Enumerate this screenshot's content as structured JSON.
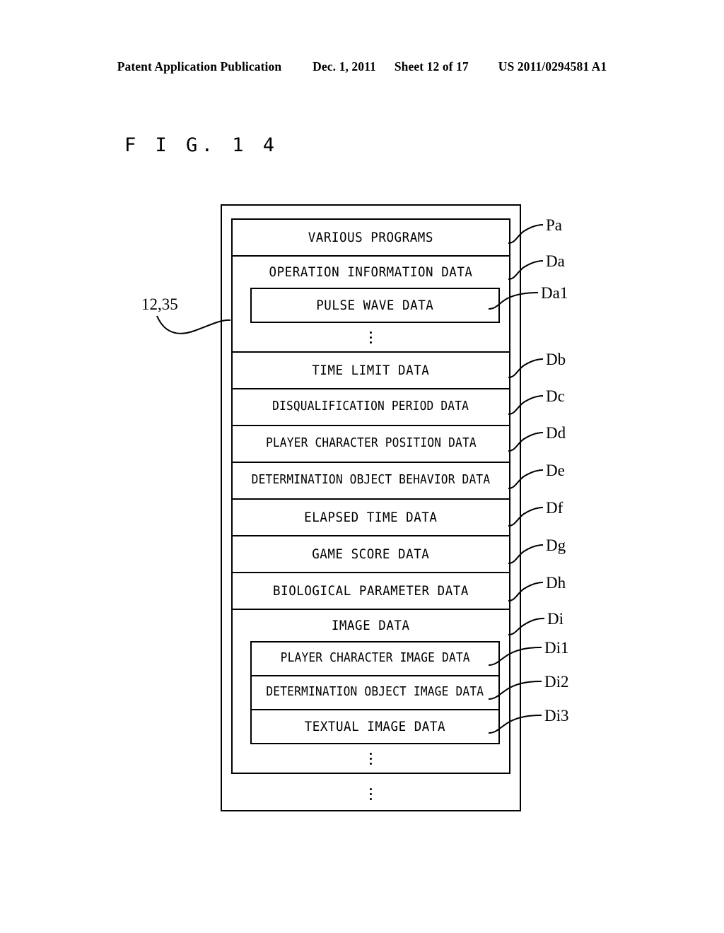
{
  "header": {
    "publication": "Patent Application Publication",
    "date": "Dec. 1, 2011",
    "sheet": "Sheet 12 of 17",
    "doc_number": "US 2011/0294581 A1"
  },
  "figure": {
    "title": "F I G.  1 4",
    "memory_ref": "12,35"
  },
  "diagram": {
    "rows": [
      {
        "id": "various-programs",
        "text": "VARIOUS PROGRAMS",
        "ref": "Pa"
      },
      {
        "id": "operation-information-data",
        "text": "OPERATION INFORMATION DATA",
        "ref": "Da"
      },
      {
        "id": "pulse-wave-data",
        "text": "PULSE WAVE DATA",
        "ref": "Da1"
      },
      {
        "id": "time-limit-data",
        "text": "TIME LIMIT DATA",
        "ref": "Db"
      },
      {
        "id": "disqualification-period-data",
        "text": "DISQUALIFICATION PERIOD DATA",
        "ref": "Dc"
      },
      {
        "id": "player-character-position-data",
        "text": "PLAYER CHARACTER POSITION DATA",
        "ref": "Dd"
      },
      {
        "id": "determination-object-behavior-data",
        "text": "DETERMINATION OBJECT BEHAVIOR DATA",
        "ref": "De"
      },
      {
        "id": "elapsed-time-data",
        "text": "ELAPSED TIME DATA",
        "ref": "Df"
      },
      {
        "id": "game-score-data",
        "text": "GAME SCORE DATA",
        "ref": "Dg"
      },
      {
        "id": "biological-parameter-data",
        "text": "BIOLOGICAL PARAMETER DATA",
        "ref": "Dh"
      },
      {
        "id": "image-data",
        "text": "IMAGE DATA",
        "ref": "Di"
      },
      {
        "id": "player-character-image-data",
        "text": "PLAYER CHARACTER IMAGE DATA",
        "ref": "Di1"
      },
      {
        "id": "determination-object-image-data",
        "text": "DETERMINATION OBJECT IMAGE DATA",
        "ref": "Di2"
      },
      {
        "id": "textual-image-data",
        "text": "TEXTUAL IMAGE DATA",
        "ref": "Di3"
      }
    ]
  }
}
